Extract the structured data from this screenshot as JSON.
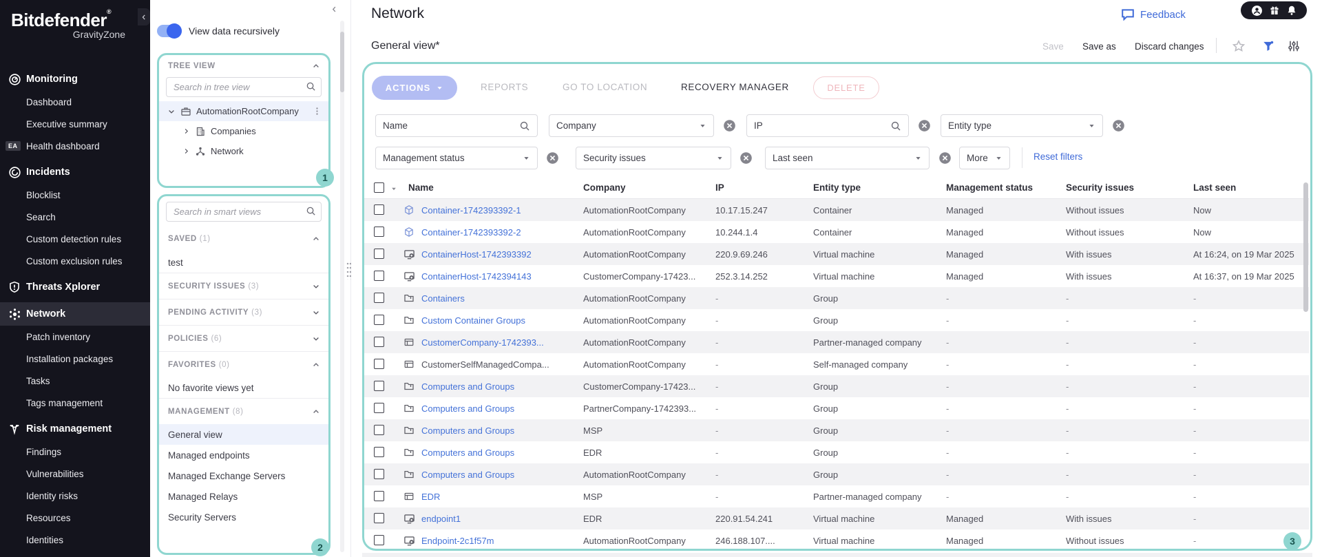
{
  "brand": {
    "name": "Bitdefender",
    "reg": "®",
    "sub": "GravityZone"
  },
  "sidebar": {
    "items": [
      {
        "label": "Monitoring",
        "icon": "monitoring-icon",
        "section": true
      },
      {
        "label": "Dashboard"
      },
      {
        "label": "Executive summary"
      },
      {
        "label": "Health dashboard",
        "badge": "EA"
      },
      {
        "label": "Incidents",
        "icon": "incidents-icon",
        "section": true
      },
      {
        "label": "Blocklist"
      },
      {
        "label": "Search"
      },
      {
        "label": "Custom detection rules"
      },
      {
        "label": "Custom exclusion rules"
      },
      {
        "label": "Threats Xplorer",
        "icon": "threats-icon",
        "section": true
      },
      {
        "label": "Network",
        "icon": "network-icon",
        "section": true,
        "selected": true
      },
      {
        "label": "Patch inventory"
      },
      {
        "label": "Installation packages"
      },
      {
        "label": "Tasks"
      },
      {
        "label": "Tags management"
      },
      {
        "label": "Risk management",
        "icon": "risk-icon",
        "section": true
      },
      {
        "label": "Findings"
      },
      {
        "label": "Vulnerabilities"
      },
      {
        "label": "Identity risks"
      },
      {
        "label": "Resources"
      },
      {
        "label": "Identities"
      }
    ]
  },
  "panel": {
    "toggle_label": "View data recursively",
    "tree": {
      "title": "TREE VIEW",
      "search_placeholder": "Search in tree view",
      "root": {
        "label": "AutomationRootCompany",
        "icon": "briefcase-icon"
      },
      "children": [
        {
          "label": "Companies",
          "icon": "building-icon"
        },
        {
          "label": "Network",
          "icon": "network-node-icon"
        }
      ]
    },
    "smart": {
      "search_placeholder": "Search in smart views",
      "sections": [
        {
          "label": "SAVED",
          "count": "(1)",
          "expanded": true,
          "items": [
            "test"
          ]
        },
        {
          "label": "SECURITY ISSUES",
          "count": "(3)",
          "expanded": false,
          "items": []
        },
        {
          "label": "PENDING ACTIVITY",
          "count": "(3)",
          "expanded": false,
          "items": []
        },
        {
          "label": "POLICIES",
          "count": "(6)",
          "expanded": false,
          "items": []
        },
        {
          "label": "FAVORITES",
          "count": "(0)",
          "expanded": true,
          "items": [
            "No favorite views yet"
          ],
          "muted_items": true
        },
        {
          "label": "MANAGEMENT",
          "count": "(8)",
          "expanded": true,
          "items": [
            "General view",
            "Managed endpoints",
            "Managed Exchange Servers",
            "Managed Relays",
            "Security Servers"
          ],
          "selected": "General view"
        }
      ]
    }
  },
  "header": {
    "title": "Network",
    "view_name": "General view*",
    "feedback_label": "Feedback",
    "save_label": "Save",
    "save_as_label": "Save as",
    "discard_label": "Discard changes"
  },
  "actions_bar": {
    "actions_label": "ACTIONS",
    "reports_label": "REPORTS",
    "goto_label": "GO TO LOCATION",
    "recovery_label": "RECOVERY MANAGER",
    "delete_label": "DELETE"
  },
  "filters": {
    "row1": [
      {
        "label": "Name",
        "type": "search"
      },
      {
        "label": "Company",
        "type": "select",
        "clearable": true
      },
      {
        "label": "IP",
        "type": "search",
        "clearable": true
      },
      {
        "label": "Entity type",
        "type": "select",
        "clearable": true
      }
    ],
    "row2": [
      {
        "label": "Management status",
        "type": "select",
        "clearable": true
      },
      {
        "label": "Security issues",
        "type": "select",
        "clearable": true
      },
      {
        "label": "Last seen",
        "type": "select",
        "clearable": true
      },
      {
        "label": "More",
        "type": "more"
      }
    ],
    "reset_label": "Reset filters"
  },
  "table": {
    "columns": [
      "Name",
      "Company",
      "IP",
      "Entity type",
      "Management status",
      "Security issues",
      "Last seen"
    ],
    "rows": [
      {
        "name": "Container-1742393392-1",
        "icon": "container-icon",
        "link": true,
        "company": "AutomationRootCompany",
        "ip": "10.17.15.247",
        "entity": "Container",
        "management": "Managed",
        "security": "Without issues",
        "last_seen": "Now"
      },
      {
        "name": "Container-1742393392-2",
        "icon": "container-icon",
        "link": true,
        "company": "AutomationRootCompany",
        "ip": "10.244.1.4",
        "entity": "Container",
        "management": "Managed",
        "security": "Without issues",
        "last_seen": "Now"
      },
      {
        "name": "ContainerHost-1742393392",
        "icon": "vm-icon",
        "link": true,
        "company": "AutomationRootCompany",
        "ip": "220.9.69.246",
        "entity": "Virtual machine",
        "management": "Managed",
        "security": "With issues",
        "last_seen": "At 16:24, on 19 Mar 2025"
      },
      {
        "name": "ContainerHost-1742394143",
        "icon": "vm-icon",
        "link": true,
        "company": "CustomerCompany-17423...",
        "ip": "252.3.14.252",
        "entity": "Virtual machine",
        "management": "Managed",
        "security": "With issues",
        "last_seen": "At 16:37, on 19 Mar 2025"
      },
      {
        "name": "Containers",
        "icon": "folder-icon",
        "link": true,
        "company": "AutomationRootCompany",
        "ip": "-",
        "entity": "Group",
        "management": "-",
        "security": "-",
        "last_seen": "-"
      },
      {
        "name": "Custom Container Groups",
        "icon": "folder-icon",
        "link": true,
        "company": "AutomationRootCompany",
        "ip": "-",
        "entity": "Group",
        "management": "-",
        "security": "-",
        "last_seen": "-"
      },
      {
        "name": "CustomerCompany-1742393...",
        "icon": "company-icon",
        "link": true,
        "company": "AutomationRootCompany",
        "ip": "-",
        "entity": "Partner-managed company",
        "management": "-",
        "security": "-",
        "last_seen": "-"
      },
      {
        "name": "CustomerSelfManagedCompa...",
        "icon": "company-icon",
        "link": false,
        "company": "AutomationRootCompany",
        "ip": "-",
        "entity": "Self-managed company",
        "management": "-",
        "security": "-",
        "last_seen": "-"
      },
      {
        "name": "Computers and Groups",
        "icon": "folder-icon",
        "link": true,
        "company": "CustomerCompany-17423...",
        "ip": "-",
        "entity": "Group",
        "management": "-",
        "security": "-",
        "last_seen": "-"
      },
      {
        "name": "Computers and Groups",
        "icon": "folder-icon",
        "link": true,
        "company": "PartnerCompany-1742393...",
        "ip": "-",
        "entity": "Group",
        "management": "-",
        "security": "-",
        "last_seen": "-"
      },
      {
        "name": "Computers and Groups",
        "icon": "folder-icon",
        "link": true,
        "company": "MSP",
        "ip": "-",
        "entity": "Group",
        "management": "-",
        "security": "-",
        "last_seen": "-"
      },
      {
        "name": "Computers and Groups",
        "icon": "folder-icon",
        "link": true,
        "company": "EDR",
        "ip": "-",
        "entity": "Group",
        "management": "-",
        "security": "-",
        "last_seen": "-"
      },
      {
        "name": "Computers and Groups",
        "icon": "folder-icon",
        "link": true,
        "company": "AutomationRootCompany",
        "ip": "-",
        "entity": "Group",
        "management": "-",
        "security": "-",
        "last_seen": "-"
      },
      {
        "name": "EDR",
        "icon": "company-icon",
        "link": true,
        "company": "MSP",
        "ip": "-",
        "entity": "Partner-managed company",
        "management": "-",
        "security": "-",
        "last_seen": "-"
      },
      {
        "name": "endpoint1",
        "icon": "vm-icon",
        "link": true,
        "company": "EDR",
        "ip": "220.91.54.241",
        "entity": "Virtual machine",
        "management": "Managed",
        "security": "With issues",
        "last_seen": "-"
      },
      {
        "name": "Endpoint-2c1f57m",
        "icon": "vm-icon",
        "link": true,
        "company": "AutomationRootCompany",
        "ip": "246.188.107....",
        "entity": "Virtual machine",
        "management": "Managed",
        "security": "Without issues",
        "last_seen": "-"
      }
    ]
  },
  "annotations": [
    "1",
    "2",
    "3"
  ],
  "colors": {
    "annotation_teal": "#8fd6d0",
    "link_blue": "#4472d8",
    "accent_blue": "#3f6ad8",
    "sidebar_dark": "#14141d",
    "row_stripe": "#f2f2f4",
    "actions_pill": "#b3bdf3",
    "delete_pink": "#efb6bc"
  }
}
